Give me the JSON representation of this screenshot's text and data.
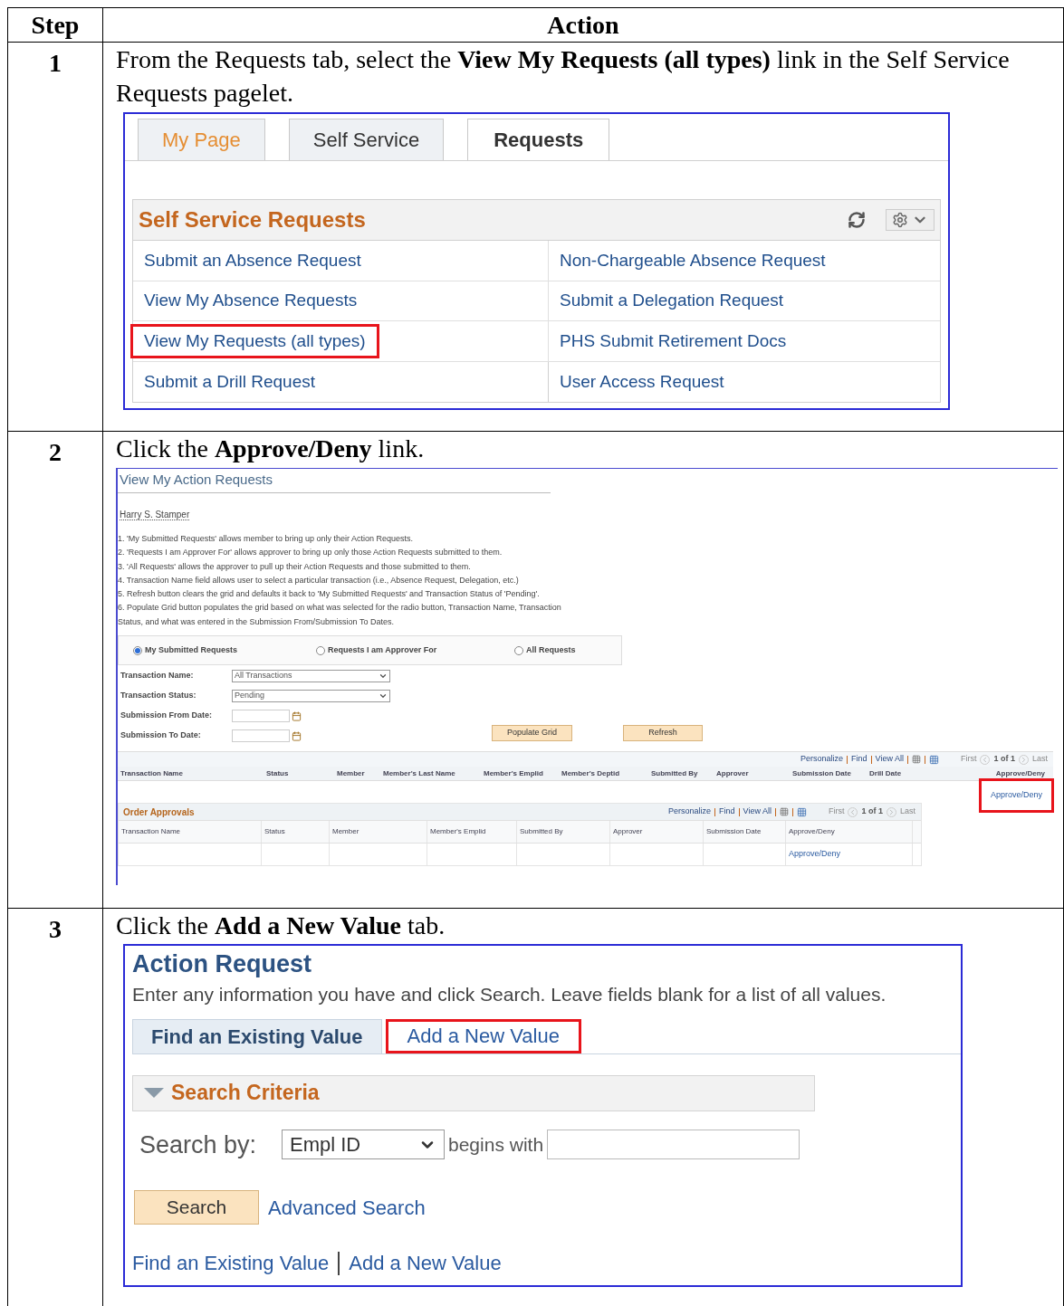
{
  "table": {
    "columns": [
      "Step",
      "Action"
    ],
    "rows": [
      {
        "step": "1",
        "instruction": "From the Requests tab, select the **View My Requests (all types)** link in the Self Service Requests pagelet.",
        "screen": {
          "kind": "pagelet",
          "tabs": [
            {
              "label": "My Page",
              "selected": false,
              "color": "#e58e33"
            },
            {
              "label": "Self Service",
              "selected": false,
              "color": "#333333"
            },
            {
              "label": "Requests",
              "selected": true,
              "color": "#333333"
            }
          ],
          "title": "Self Service Requests",
          "links": [
            {
              "label": "Submit an Absence Request",
              "highlighted": false
            },
            {
              "label": "Non-Chargeable Absence Request",
              "highlighted": false
            },
            {
              "label": "View My Absence Requests",
              "highlighted": false
            },
            {
              "label": "Submit a Delegation Request",
              "highlighted": false
            },
            {
              "label": "View My Requests (all types)",
              "highlighted": true
            },
            {
              "label": "PHS Submit Retirement Docs",
              "highlighted": false
            },
            {
              "label": "Submit a Drill Request",
              "highlighted": false
            },
            {
              "label": "User Access Request",
              "highlighted": false
            }
          ]
        }
      },
      {
        "step": "2",
        "instruction": "Click the **Approve/Deny** link.",
        "screen": {
          "kind": "action_requests",
          "title": "View My Action Requests",
          "user": "Harry S. Stamper",
          "notes": [
            "1. 'My Submitted Requests' allows member to bring up only their Action Requests.",
            "2. 'Requests I am Approver For' allows approver to bring up only those Action Requests submitted to them.",
            "3. 'All Requests' allows the approver to pull up their Action Requests and those submitted to them.",
            "4. Transaction Name field allows user to select a particular transaction (i.e., Absence Request, Delegation, etc.)",
            "5. Refresh button clears the grid and defaults it back to 'My Submitted Requests' and Transaction Status of 'Pending'.",
            "6. Populate Grid button populates the grid based on what was selected for the radio button, Transaction Name, Transaction Status, and what was entered in the Submission From/Submission To Dates."
          ],
          "radios": [
            {
              "label": "My Submitted Requests",
              "selected": true
            },
            {
              "label": "Requests I am Approver For",
              "selected": false
            },
            {
              "label": "All Requests",
              "selected": false
            }
          ],
          "fields": [
            {
              "kind": "select",
              "label": "Transaction Name:",
              "value": "All Transactions"
            },
            {
              "kind": "select",
              "label": "Transaction Status:",
              "value": "Pending"
            },
            {
              "kind": "date",
              "label": "Submission From Date:"
            },
            {
              "kind": "date",
              "label": "Submission To Date:"
            }
          ],
          "buttons": [
            "Populate Grid",
            "Refresh"
          ],
          "grids": [
            {
              "toolbar": [
                "Personalize",
                "Find",
                "View All"
              ],
              "nav": [
                "First",
                "1 of 1",
                "Last"
              ],
              "columns": [
                "Transaction Name",
                "Status",
                "Member",
                "Member's Last Name",
                "Member's Emplid",
                "Member's Deptid",
                "Submitted By",
                "Approver",
                "Submission Date",
                "Drill Date",
                "Approve/Deny"
              ],
              "row_link": {
                "label": "Approve/Deny",
                "highlighted": true
              }
            },
            {
              "title": "Order Approvals",
              "toolbar": [
                "Personalize",
                "Find",
                "View All"
              ],
              "nav": [
                "First",
                "1 of 1",
                "Last"
              ],
              "columns": [
                "Transaction Name",
                "Status",
                "Member",
                "Member's Emplid",
                "Submitted By",
                "Approver",
                "Submission Date",
                "Approve/Deny"
              ],
              "row_link": {
                "label": "Approve/Deny",
                "highlighted": false
              }
            }
          ]
        }
      },
      {
        "step": "3",
        "instruction": "Click the **Add a New Value** tab.",
        "screen": {
          "kind": "search_page",
          "title": "Action Request",
          "hint": "Enter any information you have and click Search. Leave fields blank for a list of all values.",
          "tabs": [
            {
              "label": "Find an Existing Value",
              "selected": true,
              "highlighted": false
            },
            {
              "label": "Add a New Value",
              "selected": false,
              "highlighted": true
            }
          ],
          "section": {
            "title": "Search Criteria",
            "expanded": true
          },
          "search_by": {
            "label": "Search by:",
            "value": "Empl ID",
            "operator": "begins with"
          },
          "button": "Search",
          "link": "Advanced Search",
          "footer_links": [
            "Find an Existing Value",
            "Add a New Value"
          ]
        }
      }
    ]
  }
}
